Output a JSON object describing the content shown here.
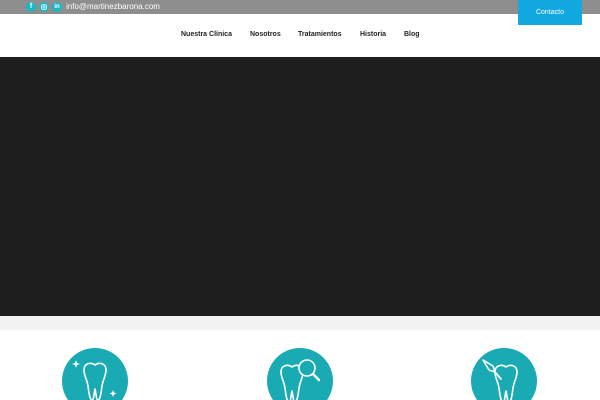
{
  "topbar": {
    "social_icons": [
      "facebook-icon",
      "instagram-icon",
      "linkedin-icon"
    ],
    "social_glyphs": {
      "facebook": "f",
      "linkedin": "in"
    },
    "email": "info@martinezbarona.com"
  },
  "contact_button": {
    "label": "Contacto"
  },
  "nav": {
    "items": [
      {
        "label": "Nuestra Clínica"
      },
      {
        "label": "Nosotros"
      },
      {
        "label": "Tratamientos"
      },
      {
        "label": "Historia"
      },
      {
        "label": "Blog"
      }
    ]
  },
  "services": {
    "icons": [
      "tooth-sparkle-icon",
      "tooth-magnifier-icon",
      "tooth-scalpel-icon"
    ]
  },
  "colors": {
    "topbar_bg": "#8e8e8e",
    "accent_blue": "#12a9e0",
    "teal": "#19aab3",
    "hero_bg": "#1e1e1e"
  }
}
